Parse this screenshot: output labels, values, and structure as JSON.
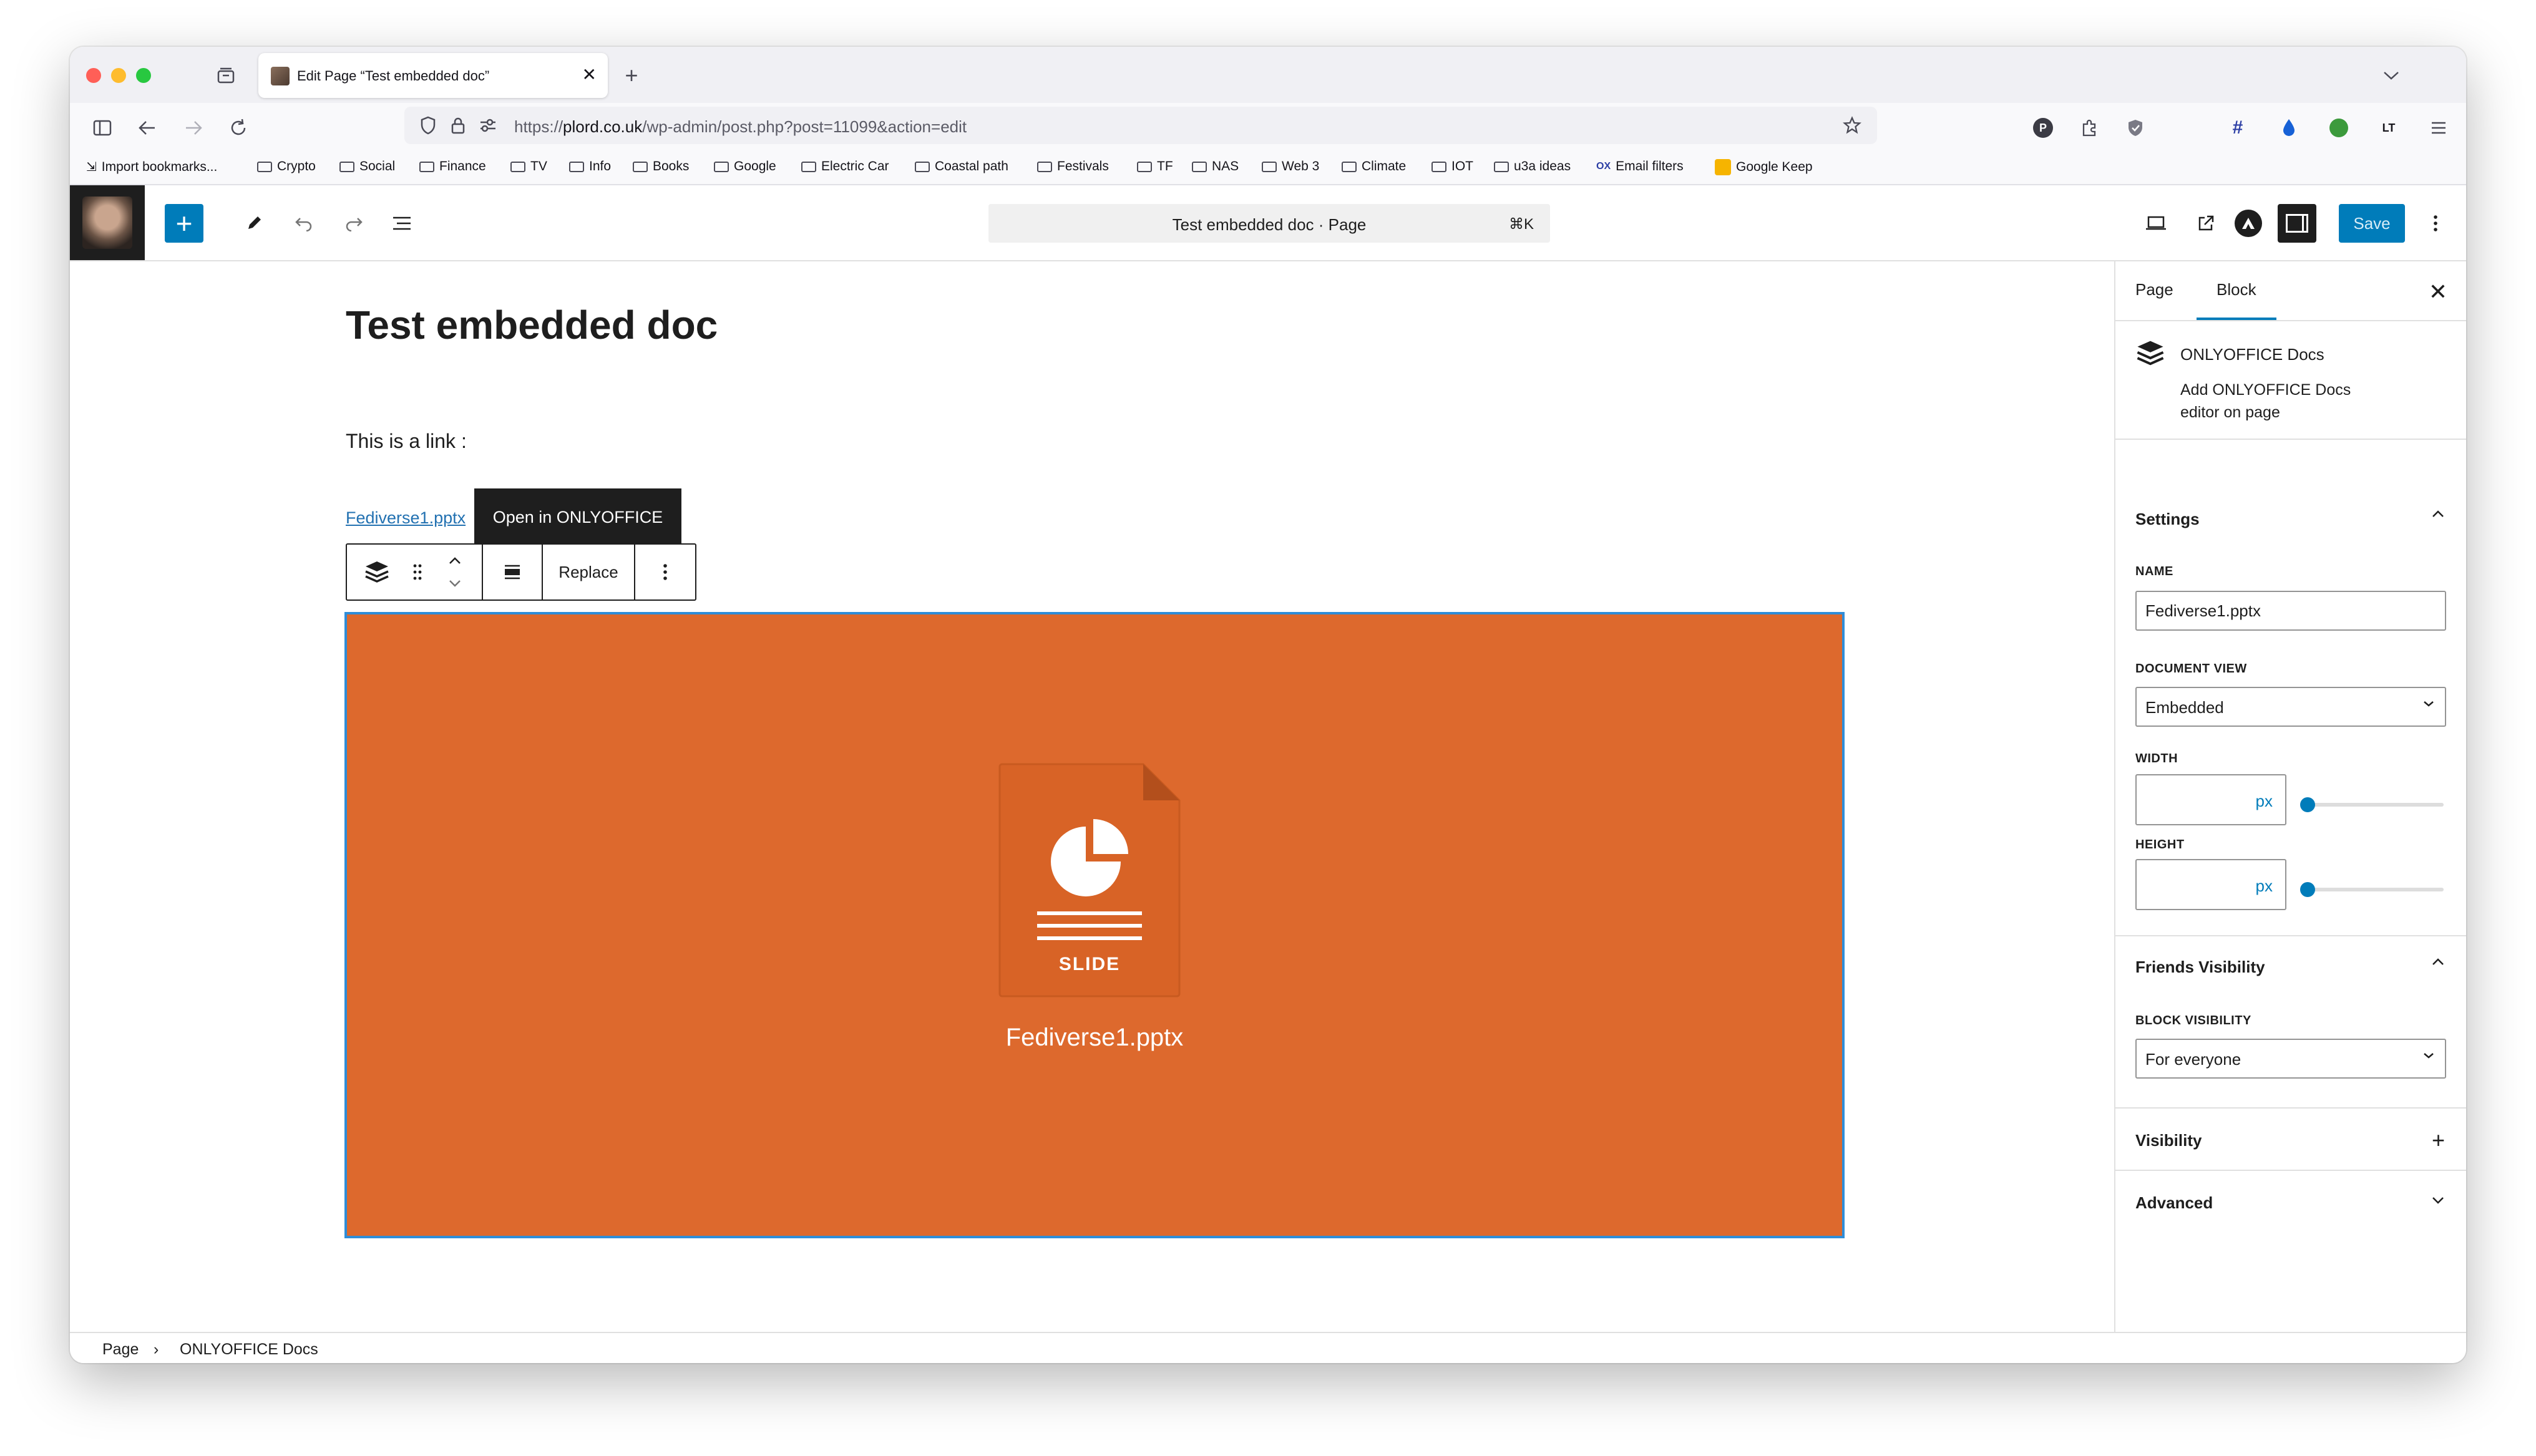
{
  "browser": {
    "tab_title": "Edit Page “Test embedded doc”",
    "url_scheme": "https://",
    "url_host": "plord.co.uk",
    "url_path": "/wp-admin/post.php?post=11099&action=edit",
    "bookmarks": [
      {
        "label": "Import bookmarks..."
      },
      {
        "label": "Crypto"
      },
      {
        "label": "Social"
      },
      {
        "label": "Finance"
      },
      {
        "label": "TV"
      },
      {
        "label": "Info"
      },
      {
        "label": "Books"
      },
      {
        "label": "Google"
      },
      {
        "label": "Electric Car"
      },
      {
        "label": "Coastal path"
      },
      {
        "label": "Festivals"
      },
      {
        "label": "TF"
      },
      {
        "label": "NAS"
      },
      {
        "label": "Web 3"
      },
      {
        "label": "Climate"
      },
      {
        "label": "IOT"
      },
      {
        "label": "u3a ideas"
      },
      {
        "label": "Email filters"
      },
      {
        "label": "Google Keep"
      }
    ]
  },
  "editor": {
    "command_title": "Test embedded doc · Page",
    "command_shortcut": "⌘K",
    "save_label": "Save"
  },
  "content": {
    "post_title": "Test embedded doc",
    "paragraph": "This is a link :",
    "file_link": "Fediverse1.pptx",
    "open_button": "Open in ONLYOFFICE",
    "replace_label": "Replace",
    "embed_type_label": "SLIDE",
    "embed_file_name": "Fediverse1.pptx",
    "embed_color": "#dd692d"
  },
  "sidebar": {
    "tab_page": "Page",
    "tab_block": "Block",
    "block_name": "ONLYOFFICE Docs",
    "block_description": "Add ONLYOFFICE Docs editor on page",
    "settings_title": "Settings",
    "name_label": "NAME",
    "name_value": "Fediverse1.pptx",
    "document_view_label": "DOCUMENT VIEW",
    "document_view_value": "Embedded",
    "width_label": "WIDTH",
    "width_unit": "px",
    "height_label": "HEIGHT",
    "height_unit": "px",
    "friends_visibility_title": "Friends Visibility",
    "block_visibility_label": "BLOCK VISIBILITY",
    "block_visibility_value": "For everyone",
    "visibility_title": "Visibility",
    "advanced_title": "Advanced",
    "accent_color": "#007cba"
  },
  "footer": {
    "crumb_page": "Page",
    "crumb_block": "ONLYOFFICE Docs"
  }
}
